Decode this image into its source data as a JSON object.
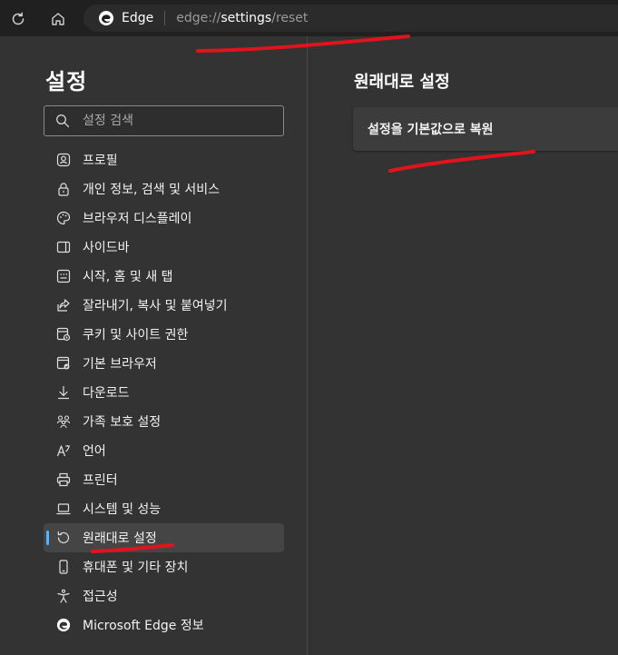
{
  "address_bar": {
    "site_name": "Edge",
    "url_prefix": "edge://",
    "url_bold": "settings",
    "url_suffix": "/reset"
  },
  "sidebar": {
    "title": "설정",
    "search_placeholder": "설정 검색",
    "items": [
      {
        "label": "프로필",
        "icon": "profile-icon"
      },
      {
        "label": "개인 정보, 검색 및 서비스",
        "icon": "lock-icon"
      },
      {
        "label": "브라우저 디스플레이",
        "icon": "palette-icon"
      },
      {
        "label": "사이드바",
        "icon": "sidebar-icon"
      },
      {
        "label": "시작, 홈 및 새 탭",
        "icon": "home-tabs-icon"
      },
      {
        "label": "잘라내기, 복사 및 붙여넣기",
        "icon": "share-icon"
      },
      {
        "label": "쿠키 및 사이트 권한",
        "icon": "site-permissions-icon"
      },
      {
        "label": "기본 브라우저",
        "icon": "default-browser-icon"
      },
      {
        "label": "다운로드",
        "icon": "download-icon"
      },
      {
        "label": "가족 보호 설정",
        "icon": "family-icon"
      },
      {
        "label": "언어",
        "icon": "language-icon"
      },
      {
        "label": "프린터",
        "icon": "printer-icon"
      },
      {
        "label": "시스템 및 성능",
        "icon": "laptop-icon"
      },
      {
        "label": "원래대로 설정",
        "icon": "reset-icon"
      },
      {
        "label": "휴대폰 및 기타 장치",
        "icon": "phone-icon"
      },
      {
        "label": "접근성",
        "icon": "accessibility-icon"
      },
      {
        "label": "Microsoft Edge 정보",
        "icon": "edge-logo-icon"
      }
    ],
    "active_index": 13
  },
  "main": {
    "title": "원래대로 설정",
    "card_label": "설정을 기본값으로 복원"
  },
  "colors": {
    "accent": "#5fb2f2",
    "annotation": "#e0141c",
    "background": "#333333",
    "topbar": "#202020"
  }
}
